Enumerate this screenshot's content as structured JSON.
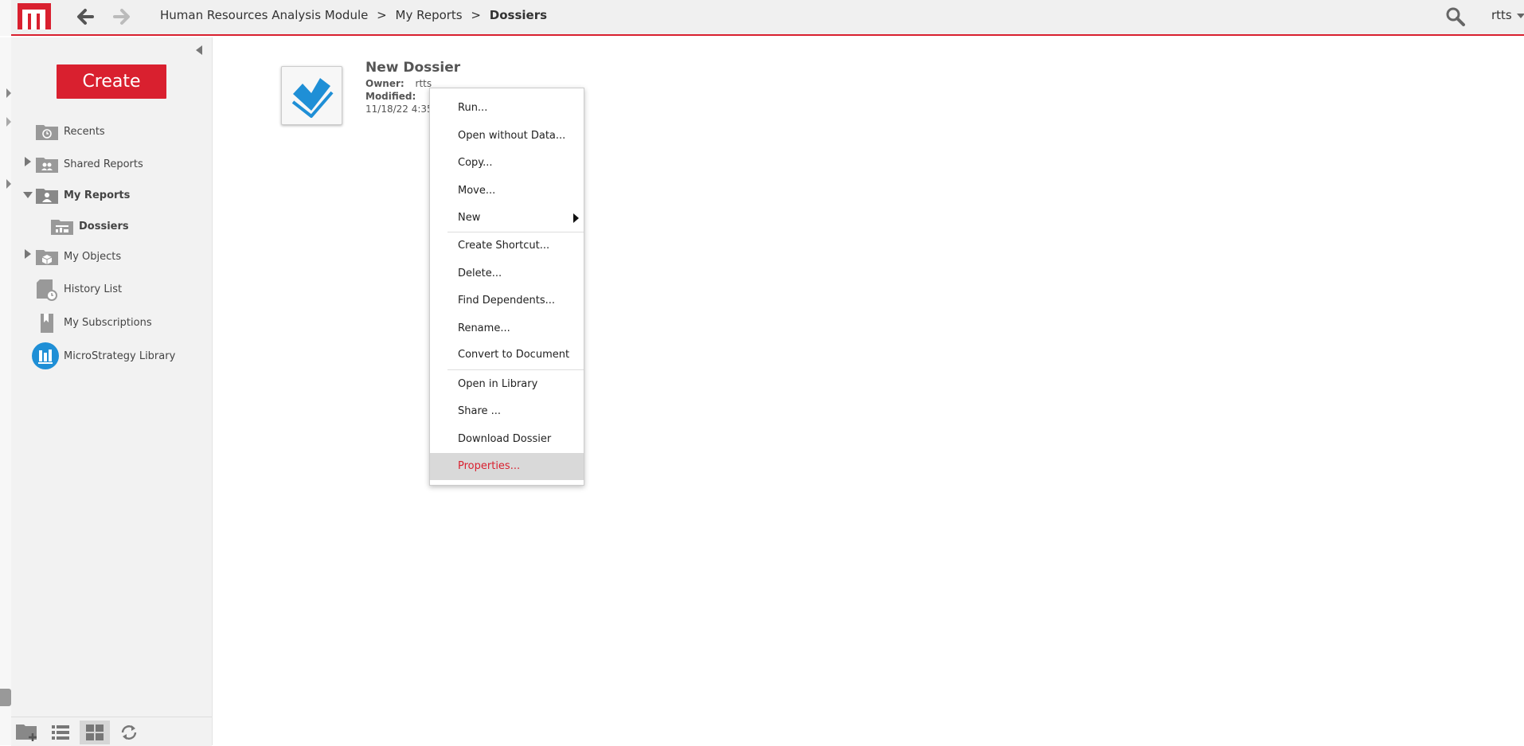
{
  "header": {
    "breadcrumb": [
      "Human Resources Analysis Module",
      "My Reports",
      "Dossiers"
    ],
    "separator": ">",
    "user": "rtts",
    "icons": [
      "logo-icon",
      "back-arrow-icon",
      "forward-arrow-icon",
      "search-icon",
      "caret-down-icon"
    ]
  },
  "sidebar": {
    "create_label": "Create",
    "items": [
      {
        "label": "Recents",
        "icon": "recents-folder-icon"
      },
      {
        "label": "Shared Reports",
        "icon": "shared-folder-icon"
      },
      {
        "label": "My Reports",
        "icon": "user-folder-icon"
      },
      {
        "label": "Dossiers",
        "icon": "dossier-folder-icon"
      },
      {
        "label": "My Objects",
        "icon": "objects-folder-icon"
      },
      {
        "label": "History List",
        "icon": "history-list-icon"
      },
      {
        "label": "My Subscriptions",
        "icon": "subscriptions-icon"
      },
      {
        "label": "MicroStrategy Library",
        "icon": "library-icon"
      }
    ],
    "bottom_icons": [
      "new-folder-icon",
      "list-view-icon",
      "icon-view-icon",
      "refresh-icon"
    ]
  },
  "dossier": {
    "title": "New Dossier",
    "owner_label": "Owner:",
    "owner_value": "rtts",
    "modified_label": "Modified:",
    "modified_value": "11/18/22 4:35"
  },
  "context_menu": {
    "items": [
      "Run...",
      "Open without Data...",
      "Copy...",
      "Move...",
      "New",
      "Create Shortcut...",
      "Delete...",
      "Find Dependents...",
      "Rename...",
      "Convert to Document",
      "Open in Library",
      "Share ...",
      "Download Dossier",
      "Properties..."
    ],
    "selected": "Properties...",
    "accent_color": "#d9202f"
  },
  "colors": {
    "brand_red": "#d9202f",
    "library_blue": "#1f8fd6"
  }
}
